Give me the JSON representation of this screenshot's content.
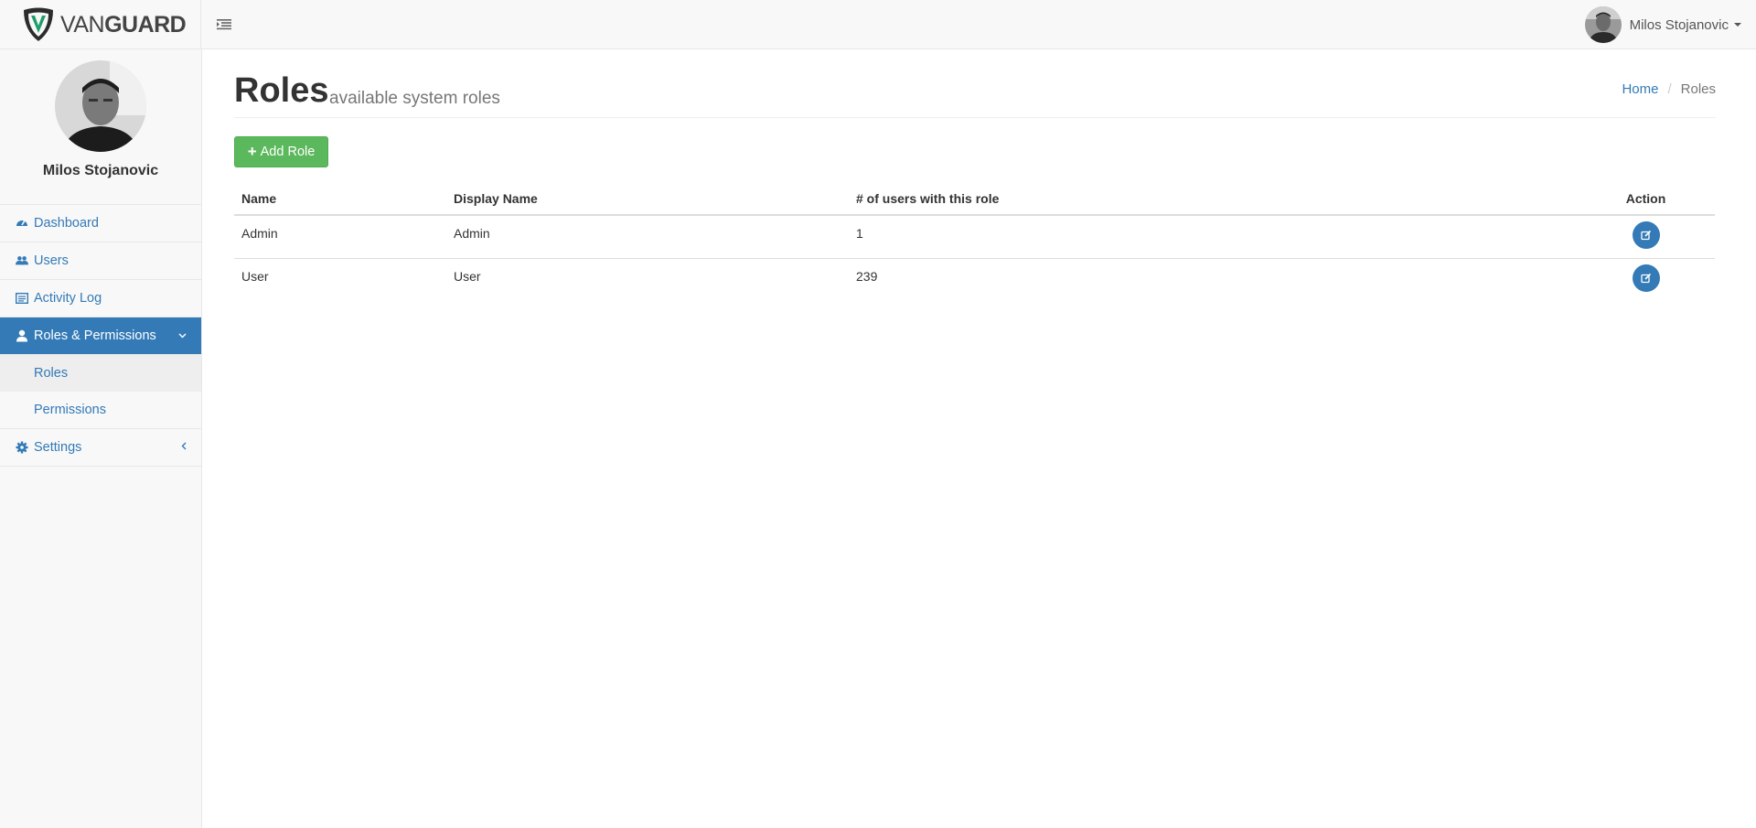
{
  "brand": {
    "name_part1": "VAN",
    "name_part2": "GUARD"
  },
  "header": {
    "user_name": "Milos Stojanovic"
  },
  "sidebar": {
    "profile_name": "Milos Stojanovic",
    "items": [
      {
        "label": "Dashboard",
        "icon": "dashboard-icon"
      },
      {
        "label": "Users",
        "icon": "users-icon"
      },
      {
        "label": "Activity Log",
        "icon": "activity-log-icon"
      },
      {
        "label": "Roles & Permissions",
        "icon": "user-icon"
      },
      {
        "label": "Settings",
        "icon": "gear-icon"
      }
    ],
    "sub_items": [
      {
        "label": "Roles"
      },
      {
        "label": "Permissions"
      }
    ]
  },
  "page": {
    "title": "Roles",
    "subtitle": "available system roles",
    "breadcrumb": {
      "home": "Home",
      "current": "Roles"
    },
    "add_button": "Add Role"
  },
  "table": {
    "columns": [
      "Name",
      "Display Name",
      "# of users with this role",
      "Action"
    ],
    "rows": [
      {
        "name": "Admin",
        "display_name": "Admin",
        "users": "1"
      },
      {
        "name": "User",
        "display_name": "User",
        "users": "239"
      }
    ]
  },
  "colors": {
    "primary": "#337ab7",
    "success": "#5cb85c",
    "brand_green": "#1e9e6a"
  }
}
